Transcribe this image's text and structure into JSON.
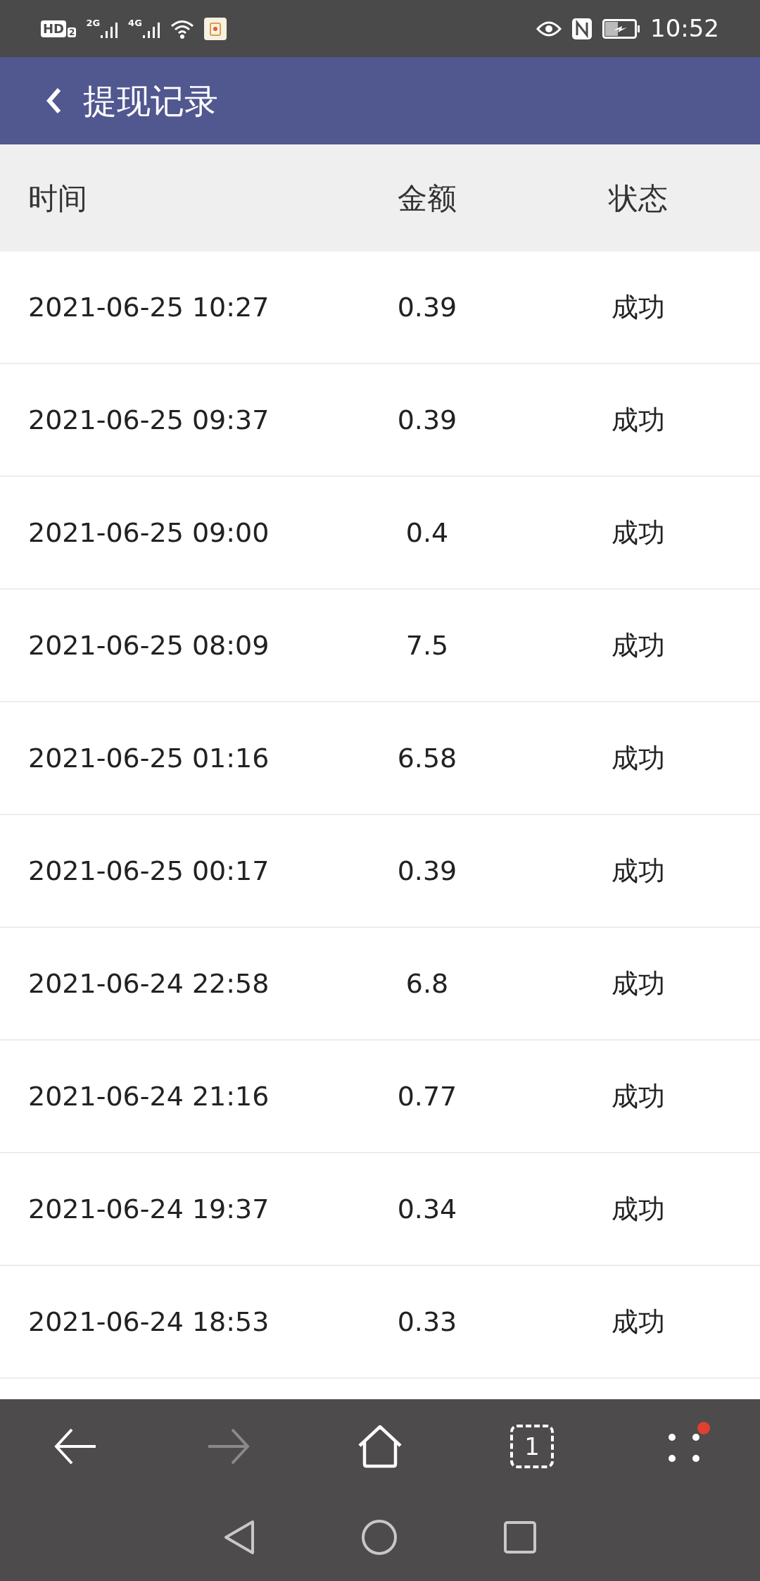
{
  "status_bar": {
    "hd_label": "HD",
    "sim_label": "2",
    "networks": [
      "2G",
      "4G"
    ],
    "time": "10:52"
  },
  "header": {
    "title": "提现记录"
  },
  "table": {
    "columns": [
      "时间",
      "金额",
      "状态"
    ],
    "rows": [
      [
        "2021-06-25 10:27",
        "0.39",
        "成功"
      ],
      [
        "2021-06-25 09:37",
        "0.39",
        "成功"
      ],
      [
        "2021-06-25 09:00",
        "0.4",
        "成功"
      ],
      [
        "2021-06-25 08:09",
        "7.5",
        "成功"
      ],
      [
        "2021-06-25 01:16",
        "6.58",
        "成功"
      ],
      [
        "2021-06-25 00:17",
        "0.39",
        "成功"
      ],
      [
        "2021-06-24 22:58",
        "6.8",
        "成功"
      ],
      [
        "2021-06-24 21:16",
        "0.77",
        "成功"
      ],
      [
        "2021-06-24 19:37",
        "0.34",
        "成功"
      ],
      [
        "2021-06-24 18:53",
        "0.33",
        "成功"
      ]
    ]
  },
  "browser_toolbar": {
    "back_disabled": false,
    "forward_disabled": true,
    "tab_count": "1",
    "menu_badge": true
  }
}
